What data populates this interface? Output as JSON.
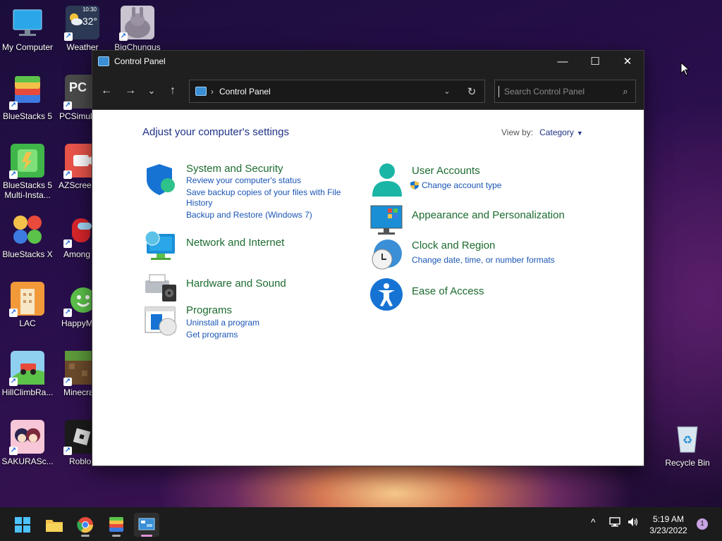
{
  "desktop": {
    "icons": [
      {
        "label": "My Computer"
      },
      {
        "label": "Weather",
        "temp": "32°",
        "time": "10:30"
      },
      {
        "label": "BigChungus"
      },
      {
        "label": "BlueStacks 5"
      },
      {
        "label": "PCSimul"
      },
      {
        "label": "BlueStacks 5 Multi-Insta..."
      },
      {
        "label": "AZScreen"
      },
      {
        "label": "BlueStacks X"
      },
      {
        "label": "Among"
      },
      {
        "label": "LAC"
      },
      {
        "label": "HappyM"
      },
      {
        "label": "HillClimbRa..."
      },
      {
        "label": "Minecra"
      },
      {
        "label": "SAKURASc..."
      },
      {
        "label": "Roblo"
      },
      {
        "label": "Recycle Bin"
      }
    ]
  },
  "window": {
    "title": "Control Panel",
    "controls": {
      "minimize": "—",
      "maximize": "☐",
      "close": "✕"
    },
    "nav": {
      "back": "←",
      "forward": "→",
      "recent": "⌄",
      "up": "↑"
    },
    "address": {
      "separator": "›",
      "crumb": "Control Panel",
      "dropdown": "⌄",
      "refresh": "↻"
    },
    "search": {
      "placeholder": "Search Control Panel",
      "icon": "⌕"
    }
  },
  "content": {
    "heading": "Adjust your computer's settings",
    "view_by_label": "View by:",
    "view_by_value": "Category",
    "categories": [
      {
        "title": "System and Security",
        "links": [
          "Review your computer's status",
          "Save backup copies of your files with File",
          "History",
          "Backup and Restore (Windows 7)"
        ],
        "icon": "shield-icon"
      },
      {
        "title": "Network and Internet",
        "links": [],
        "icon": "globe-monitor-icon"
      },
      {
        "title": "Hardware and Sound",
        "links": [],
        "icon": "printer-speaker-icon"
      },
      {
        "title": "Programs",
        "links": [
          "Uninstall a program",
          "Get programs"
        ],
        "icon": "programs-icon"
      },
      {
        "title": "User Accounts",
        "links": [
          "Change account type"
        ],
        "icon": "user-icon"
      },
      {
        "title": "Appearance and Personalization",
        "links": [],
        "icon": "monitor-colors-icon"
      },
      {
        "title": "Clock and Region",
        "links": [
          "Change date, time, or number formats"
        ],
        "icon": "clock-globe-icon"
      },
      {
        "title": "Ease of Access",
        "links": [],
        "icon": "accessibility-icon"
      }
    ]
  },
  "taskbar": {
    "time": "5:19 AM",
    "date": "3/23/2022",
    "notifications": "1",
    "tray_chevron": "^"
  },
  "colors": {
    "category_title": "#1c6b2f",
    "link": "#1a55b5",
    "heading": "#1e3287",
    "titlebar": "#1f1f1f"
  }
}
